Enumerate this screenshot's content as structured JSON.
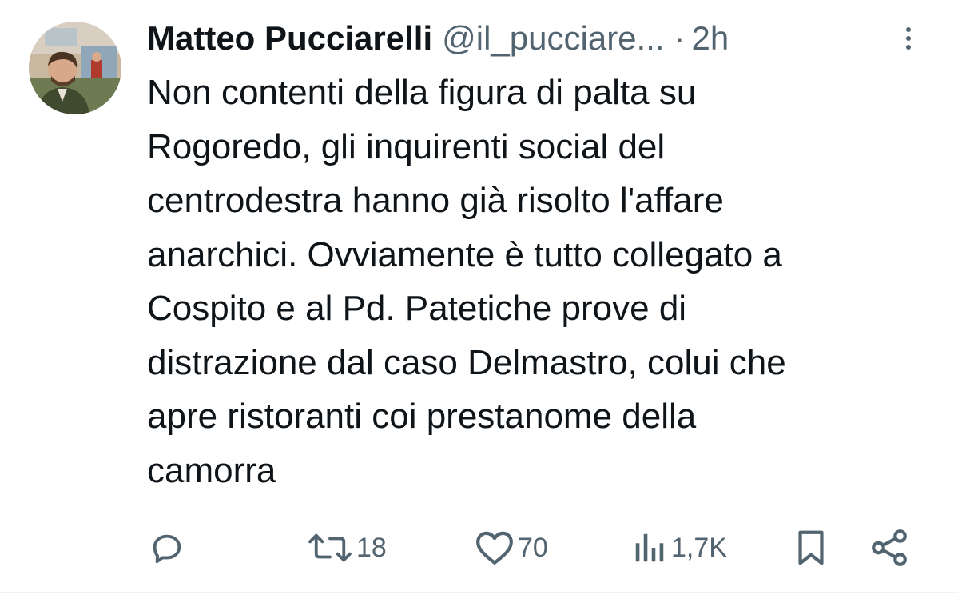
{
  "author": {
    "name": "Matteo Pucciarelli",
    "handle": "@il_pucciare...",
    "separator": "·",
    "time": "2h",
    "avatar_icon": "profile-photo"
  },
  "tweet": {
    "lines": [
      "Non contenti della figura di palta su",
      "Rogoredo, gli inquirenti social del",
      "centrodestra hanno già risolto l'affare",
      "anarchici. Ovviamente è tutto collegato a",
      "Cospito e al Pd. Patetiche prove di",
      "distrazione dal caso Delmastro, colui che",
      "apre ristoranti coi prestanome della",
      "camorra"
    ]
  },
  "actions": {
    "reply": {
      "icon": "reply-icon",
      "count": ""
    },
    "retweet": {
      "icon": "retweet-icon",
      "count": "18"
    },
    "like": {
      "icon": "heart-icon",
      "count": "70"
    },
    "views": {
      "icon": "views-icon",
      "count": "1,7K"
    },
    "bookmark": {
      "icon": "bookmark-icon"
    },
    "share": {
      "icon": "share-icon"
    }
  },
  "colors": {
    "text": "#0f1419",
    "muted": "#536471"
  }
}
